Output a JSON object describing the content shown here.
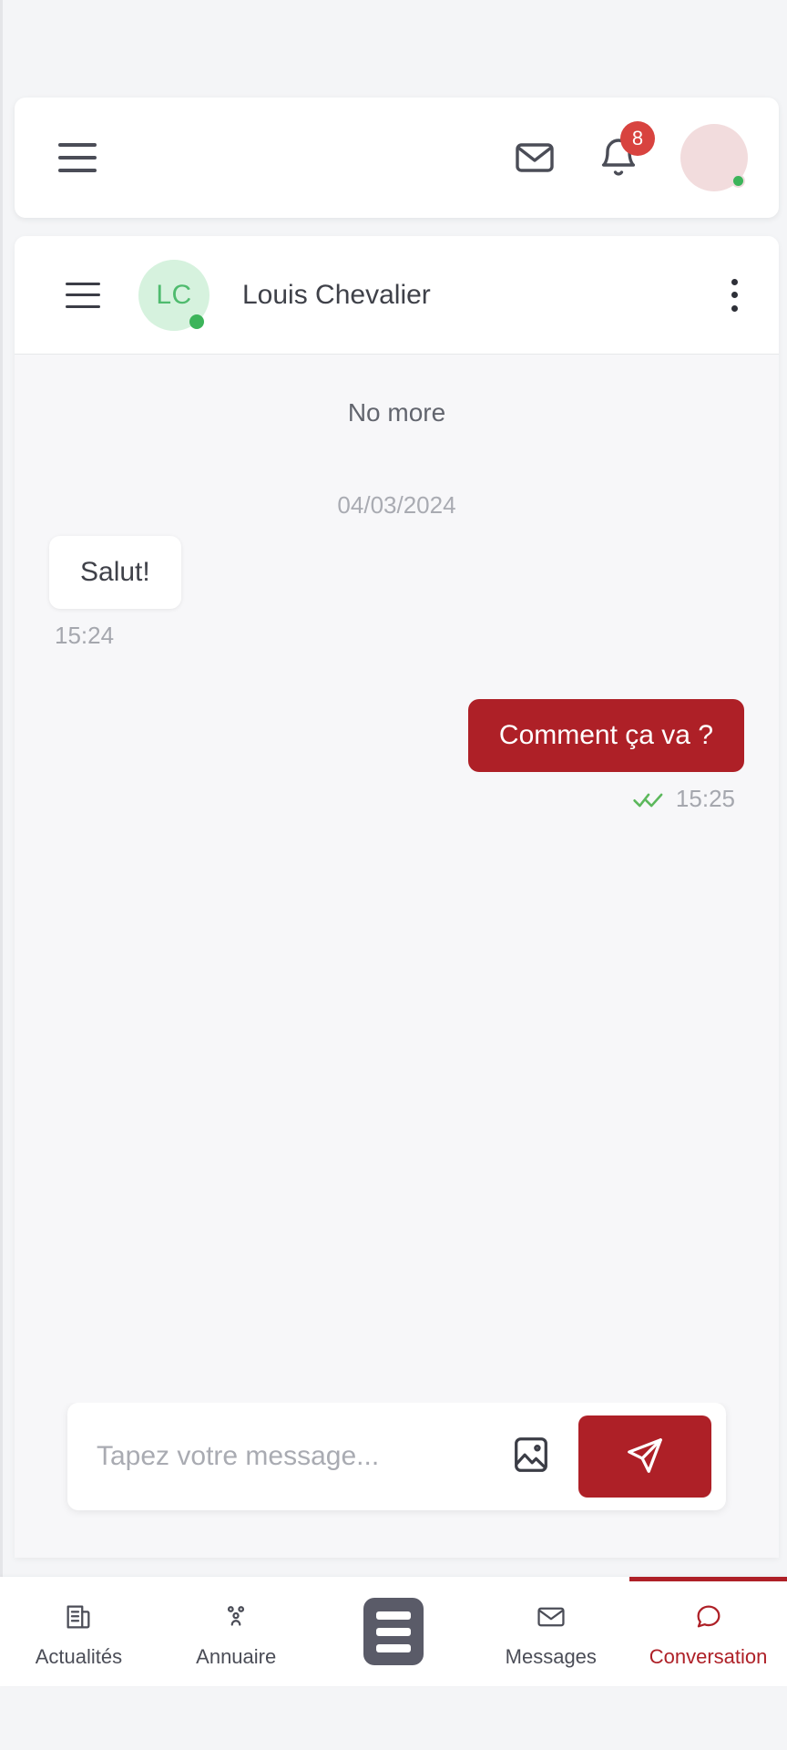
{
  "theme": {
    "brand_red": "#ae2027",
    "badge_red": "#d8433f",
    "online_green": "#3cb45a",
    "tick_green": "#5cb85c",
    "page_bg": "#f4f5f7",
    "chat_bg": "#f7f7f9"
  },
  "topbar": {
    "menu_label": "Menu",
    "mail_icon": "envelope-icon",
    "bell_icon": "bell-icon",
    "notification_count": "8",
    "avatar_status": "online"
  },
  "chat_header": {
    "menu_label": "Menu",
    "avatar_initials": "LC",
    "contact_name": "Louis Chevalier",
    "status": "online",
    "more_icon": "kebab-menu-icon"
  },
  "conversation": {
    "no_more_label": "No more",
    "date_separator": "04/03/2024",
    "messages": [
      {
        "direction": "in",
        "text": "Salut!",
        "time": "15:24",
        "read_receipt": false
      },
      {
        "direction": "out",
        "text": "Comment ça va ?",
        "time": "15:25",
        "read_receipt": true
      }
    ]
  },
  "composer": {
    "placeholder": "Tapez votre message...",
    "value": "",
    "image_icon": "image-icon",
    "send_icon": "send-icon"
  },
  "bottom_nav": {
    "items": [
      {
        "label": "Actualités",
        "icon": "news-icon",
        "active": false
      },
      {
        "label": "Annuaire",
        "icon": "people-icon",
        "active": false
      },
      {
        "label": "Messages",
        "icon": "envelope-icon",
        "active": false
      },
      {
        "label": "Conversation",
        "icon": "chat-bubble-icon",
        "active": true
      }
    ],
    "center_button": "menu-grid-button"
  }
}
